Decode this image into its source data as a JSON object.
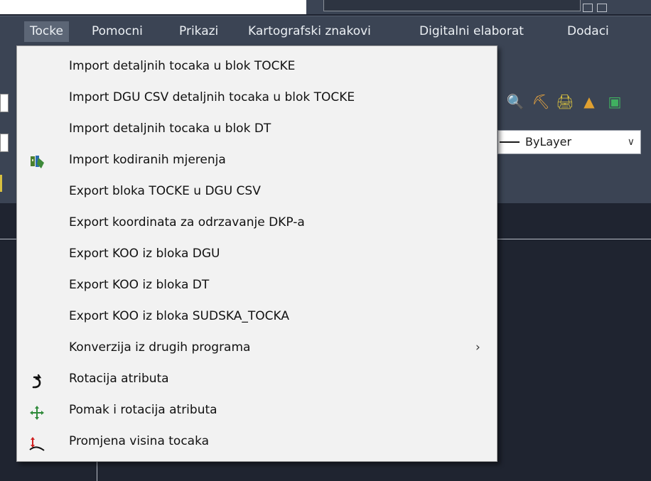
{
  "menubar": {
    "items": [
      "Tocke",
      "Pomocni",
      "Prikazi",
      "Kartografski znakovi",
      "Digitalni elaborat",
      "Dodaci"
    ]
  },
  "properties": {
    "linetype": "ByLayer"
  },
  "dropdown": {
    "items": [
      {
        "label": "Import detaljnih tocaka u blok TOCKE",
        "icon": null
      },
      {
        "label": "Import DGU CSV detaljnih tocaka u blok TOCKE",
        "icon": null
      },
      {
        "label": "Import detaljnih tocaka u blok DT",
        "icon": null
      },
      {
        "label": "Import kodiranih mjerenja",
        "icon": "survey-instrument-icon"
      },
      {
        "label": "Export bloka TOCKE u DGU CSV",
        "icon": null
      },
      {
        "label": "Export koordinata za odrzavanje DKP-a",
        "icon": null
      },
      {
        "label": "Export KOO iz bloka DGU",
        "icon": null
      },
      {
        "label": "Export KOO iz bloka DT",
        "icon": null
      },
      {
        "label": "Export KOO iz bloka SUDSKA_TOCKA",
        "icon": null
      },
      {
        "label": "Konverzija iz drugih programa",
        "icon": null,
        "submenu": true
      },
      {
        "label": "Rotacija atributa",
        "icon": "rotate-icon"
      },
      {
        "label": "Pomak i rotacija atributa",
        "icon": "move-rotate-icon"
      },
      {
        "label": "Promjena visina tocaka",
        "icon": "height-change-icon"
      }
    ]
  },
  "colors": {
    "menubar_bg": "#3b4454",
    "menu_active": "#5c6676",
    "dropdown_bg": "#f2f2f2",
    "canvas_bg": "#1f2430"
  }
}
